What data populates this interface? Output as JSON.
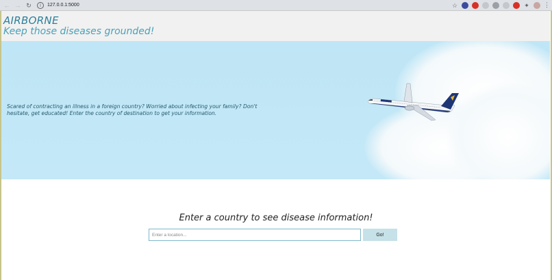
{
  "browser": {
    "url": "127.0.0.1:5000",
    "icons": [
      "back-icon",
      "forward-icon",
      "reload-icon",
      "info-icon",
      "star-icon",
      "extension-icons",
      "puzzle-icon",
      "avatar",
      "menu-icon"
    ]
  },
  "header": {
    "brand": "AIRBORNE",
    "tagline": "Keep those diseases grounded!"
  },
  "hero": {
    "text": "Scared of contracting an illness in a foreign country? Worried about infecting your family? Don't hesitate, get educated! Enter the country of destination to get your information.",
    "image": "airplane-in-sky"
  },
  "search": {
    "title": "Enter a country to see disease information!",
    "placeholder": "Enter a location...",
    "button_label": "Go!"
  },
  "colors": {
    "brand": "#2c7f9a",
    "tagline": "#4aa1b8",
    "sky": "#bfe6f6",
    "button": "#c6e1e8"
  }
}
